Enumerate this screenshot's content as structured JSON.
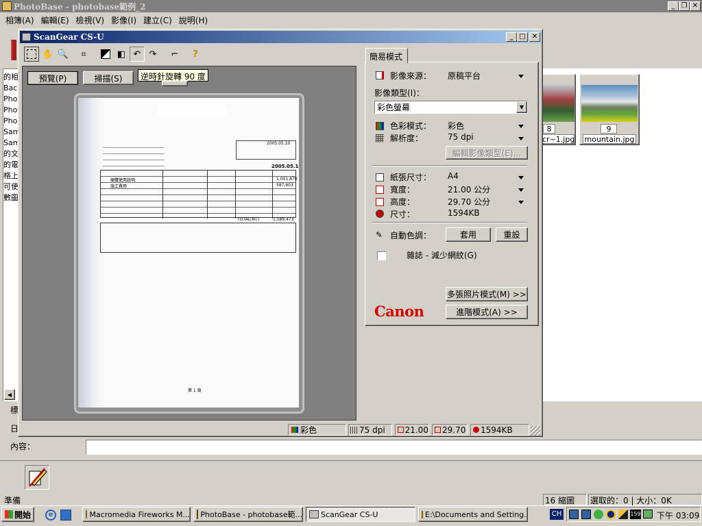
{
  "photobase": {
    "title": "PhotoBase - photobase範例_2",
    "menu": [
      "相簿(A)",
      "編輯(E)",
      "檢視(V)",
      "影像(I)",
      "建立(C)",
      "說明(H)"
    ],
    "left_list": [
      "的相",
      "Bac",
      "Pho",
      "Pho",
      "Pho",
      "Sam",
      "Sam",
      "的文",
      "的電",
      "格上",
      "可使",
      "數圖"
    ],
    "thumbnails": [
      {
        "number": "8",
        "filename": "cr~1.jpg"
      },
      {
        "number": "9",
        "filename": "mountain.jpg"
      }
    ],
    "side_labels": [
      "標",
      "日"
    ],
    "content_label": "內容：",
    "status_ready": "準備",
    "status_count": "16 縮圖",
    "status_selected": "選取的：0 | 大小：0K"
  },
  "scangear": {
    "title": "ScanGear CS-U",
    "tooltip": "逆時針旋轉 90 度",
    "preview_button": "預覽(P)",
    "scan_button": "掃描(S)",
    "tab_label": "簡易模式",
    "source_label": "影像來源：",
    "source_value": "原稿平台",
    "type_label": "影像類型(I)：",
    "type_value": "彩色螢幕",
    "color_label": "色彩模式：",
    "color_value": "彩色",
    "resolution_label": "解析度：",
    "resolution_value": "75 dpi",
    "edit_type_button": "編輯影像類型(E)...",
    "paper_label": "紙張尺寸：",
    "paper_value": "A4",
    "width_label": "寬度：",
    "width_value": "21.00 公分",
    "height_label": "高度：",
    "height_value": "29.70 公分",
    "size_label": "尺寸：",
    "size_value": "1594KB",
    "auto_tone_label": "自動色調：",
    "apply_button": "套用",
    "reset_button": "重設",
    "descreen_label": "雜誌 - 減少網紋(G)",
    "multi_photo_button": "多張照片模式(M) >>",
    "advanced_button": "進階模式(A) >>",
    "brand": "Canon",
    "brand_color": "#d40000",
    "status": {
      "color": "彩色",
      "dpi": "75 dpi",
      "width": "21.00",
      "height": "29.70",
      "size": "1594KB"
    }
  },
  "document": {
    "date1": "2005.05.10",
    "date2": "2005.05.10",
    "rows": [
      "硬體使用說明",
      "施工費用"
    ],
    "col_headers": [
      "名",
      "稱",
      "規",
      "格",
      "單位",
      "數量",
      "單價",
      "複價"
    ],
    "total_label": "TOTAL(NT):",
    "total_value": "1,589,473",
    "amount1": "1,001,870",
    "amount2": "587,603",
    "footer_note": "第 1 頁"
  },
  "taskbar": {
    "start": "開始",
    "items": [
      "Macromedia Fireworks M...",
      "PhotoBase - photobase範...",
      "ScanGear CS-U",
      "E:\\Documents and Setting..."
    ],
    "lang": "CH",
    "clock": "下午 03:09",
    "tray_number": "159"
  }
}
